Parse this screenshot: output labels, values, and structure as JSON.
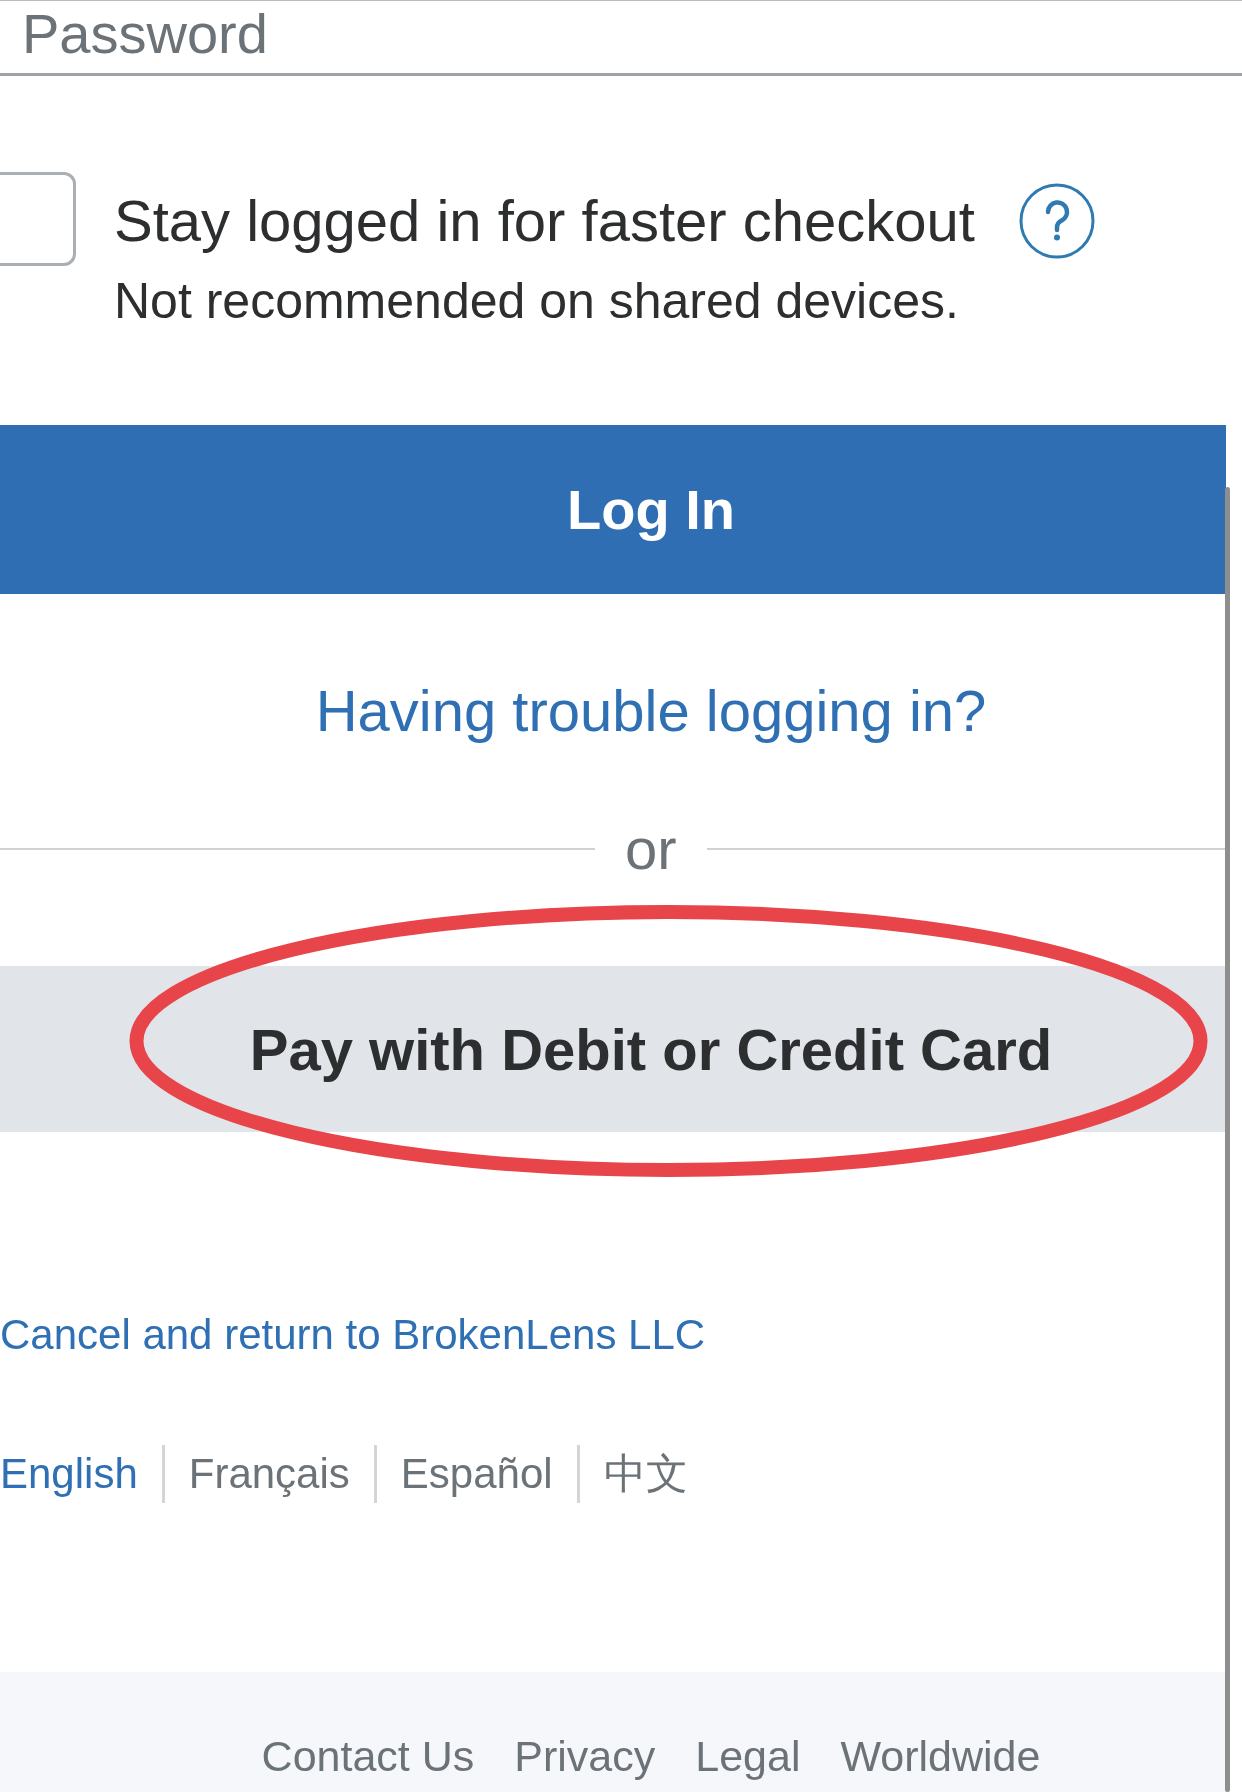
{
  "password_field": {
    "placeholder": "Password"
  },
  "stay_logged_in": {
    "checked": false,
    "label": "Stay logged in for faster checkout",
    "note": "Not recommended on shared devices."
  },
  "login_button": {
    "label": "Log In"
  },
  "trouble_link": {
    "label": "Having trouble logging in?"
  },
  "divider": {
    "label": "or"
  },
  "pay_button": {
    "label": "Pay with Debit or Credit Card",
    "circled": true
  },
  "cancel_link": {
    "label": "Cancel and return to BrokenLens LLC"
  },
  "languages": [
    {
      "label": "English",
      "selected": true
    },
    {
      "label": "Français",
      "selected": false
    },
    {
      "label": "Español",
      "selected": false
    },
    {
      "label": "中文",
      "selected": false
    }
  ],
  "footer": {
    "links": [
      "Contact Us",
      "Privacy",
      "Legal",
      "Worldwide"
    ]
  }
}
